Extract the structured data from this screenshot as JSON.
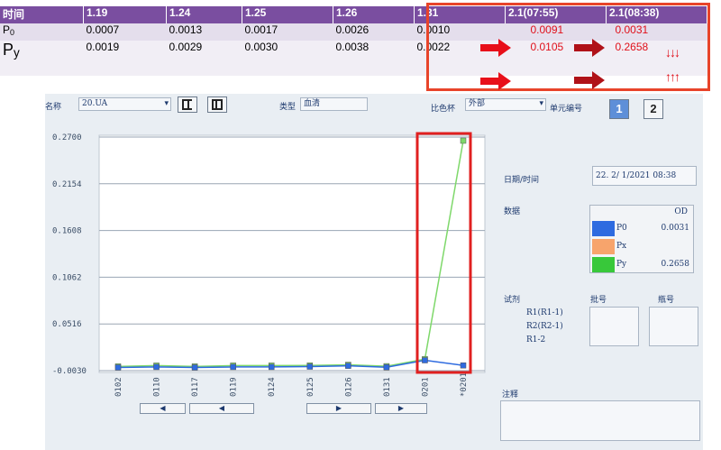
{
  "table": {
    "header": [
      "时间",
      "1.19",
      "1.24",
      "1.25",
      "1.26",
      "1.31",
      "2.1(07:55)",
      "2.1(08:38)"
    ],
    "rows": [
      {
        "label_main": "P",
        "label_sub": "0",
        "values": [
          "0.0007",
          "0.0013",
          "0.0017",
          "0.0026",
          "0.0010",
          "0.0091",
          "0.0031"
        ]
      },
      {
        "label_main": "P",
        "label_sub": "y",
        "values": [
          "0.0019",
          "0.0029",
          "0.0030",
          "0.0038",
          "0.0022",
          "0.0105",
          "0.2658"
        ]
      }
    ],
    "down_ticks": "↓↓↓",
    "up_ticks": "↑↑↑",
    "colors": {
      "header": "#7A4EA0",
      "highlight": "#E8442A",
      "red_value": "#E0101A"
    }
  },
  "app": {
    "name_label": "名称",
    "name_value": "20.UA",
    "type_label": "类型",
    "type_value": "血清",
    "cup_label": "比色杯",
    "cup_value": "外部",
    "unit_label": "单元编号",
    "unit_buttons": [
      "1",
      "2"
    ],
    "datetime_label": "日期/时间",
    "datetime_value": "22. 2/ 1/2021 08:38",
    "data_label": "数据",
    "legend_header": "OD",
    "legend": [
      {
        "name": "P0",
        "value": "0.0031",
        "color": "#2E6BE0"
      },
      {
        "name": "Px",
        "value": "",
        "color": "#F7A46C"
      },
      {
        "name": "Py",
        "value": "0.2658",
        "color": "#38C83A"
      }
    ],
    "reagent_label": "试剂",
    "batch_label": "批号",
    "bottle_label": "瓶号",
    "reagents": [
      "R1(R1-1)",
      "R2(R2-1)",
      "R1-2"
    ],
    "note_label": "注释"
  },
  "chart_data": {
    "type": "line",
    "categories": [
      "0102",
      "0110",
      "0117",
      "0119",
      "0124",
      "0125",
      "0126",
      "0131",
      "0201",
      "*0201"
    ],
    "y_ticks": [
      "0.2700",
      "0.2154",
      "0.1608",
      "0.1062",
      "0.0516",
      "-0.0030"
    ],
    "ylim": [
      -0.003,
      0.27
    ],
    "series": [
      {
        "name": "P0",
        "color": "#2E6BE0",
        "values": [
          0.0007,
          0.0013,
          0.0007,
          0.0013,
          0.0013,
          0.0017,
          0.0026,
          0.001,
          0.0091,
          0.0031
        ]
      },
      {
        "name": "Py",
        "color": "#7ED86A",
        "values": [
          0.0019,
          0.0029,
          0.0019,
          0.0029,
          0.0029,
          0.003,
          0.0038,
          0.0022,
          0.0105,
          0.2658
        ]
      }
    ],
    "grid": true
  }
}
